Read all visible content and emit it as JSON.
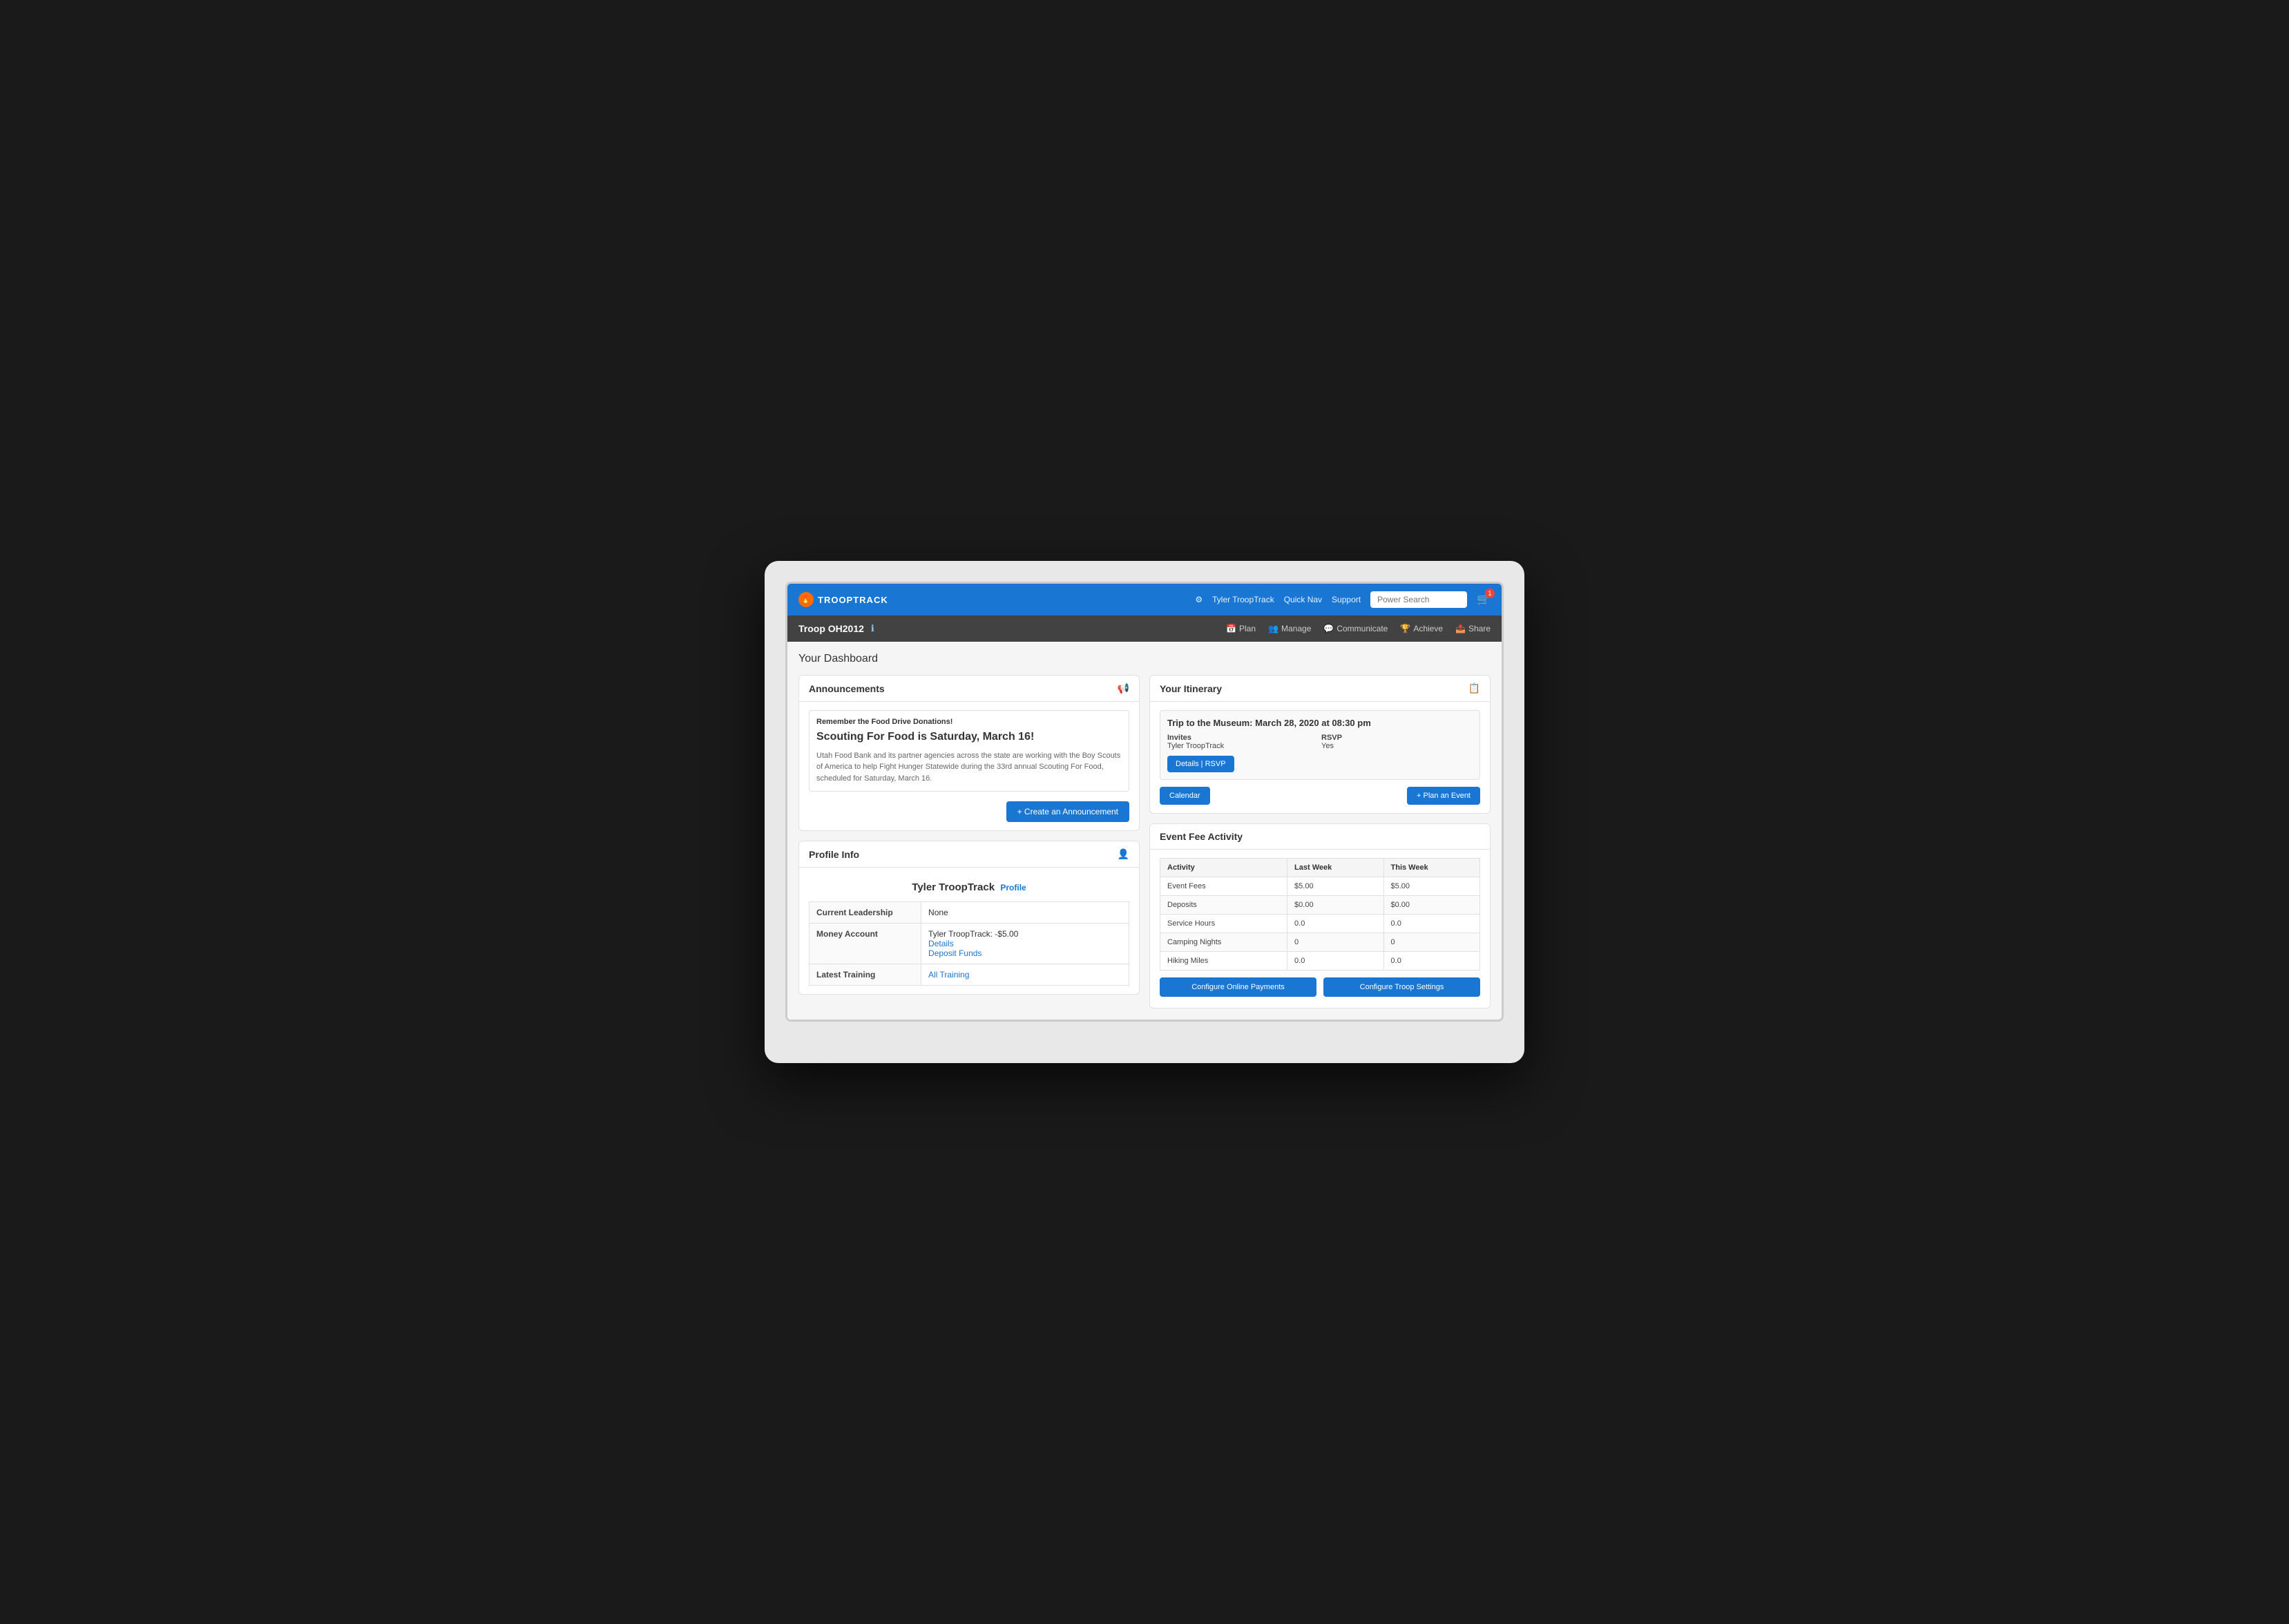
{
  "brand": {
    "name": "TROOPTRACK",
    "icon_label": "flame"
  },
  "top_nav": {
    "user_name": "Tyler TroopTrack",
    "quick_nav": "Quick Nav",
    "support": "Support",
    "search_placeholder": "Power Search",
    "cart_count": "1"
  },
  "secondary_nav": {
    "troop_name": "Troop OH2012",
    "plan": "Plan",
    "manage": "Manage",
    "communicate": "Communicate",
    "achieve": "Achieve",
    "share": "Share"
  },
  "dashboard": {
    "title": "Your Dashboard"
  },
  "announcements": {
    "header": "Announcements",
    "label": "Remember the Food Drive Donations!",
    "title": "Scouting For Food is Saturday, March 16!",
    "body": "Utah Food Bank and its partner agencies across the state are working with the Boy Scouts of America to help Fight Hunger Statewide during the 33rd annual Scouting For Food, scheduled for Saturday, March 16.",
    "create_btn": "+ Create an Announcement"
  },
  "profile_info": {
    "header": "Profile Info",
    "user_name": "Tyler TroopTrack",
    "profile_link": "Profile",
    "current_leadership_label": "Current Leadership",
    "current_leadership_value": "None",
    "money_account_label": "Money Account",
    "money_account_value": "Tyler TroopTrack: -$5.00",
    "details_link": "Details",
    "deposit_link": "Deposit Funds",
    "latest_training_label": "Latest Training",
    "all_training_link": "All Training"
  },
  "itinerary": {
    "header": "Your Itinerary",
    "event_title": "Trip to the Museum: March 28, 2020 at 08:30 pm",
    "invites_label": "Invites",
    "invites_value": "Tyler TroopTrack",
    "rsvp_label": "RSVP",
    "rsvp_value": "Yes",
    "details_rsvp_btn": "Details | RSVP",
    "calendar_btn": "Calendar",
    "plan_event_btn": "+ Plan an Event"
  },
  "event_fee": {
    "header": "Event Fee Activity",
    "columns": [
      "Activity",
      "Last Week",
      "This Week"
    ],
    "rows": [
      {
        "activity": "Event Fees",
        "last_week": "$5.00",
        "this_week": "$5.00"
      },
      {
        "activity": "Deposits",
        "last_week": "$0.00",
        "this_week": "$0.00"
      },
      {
        "activity": "Service Hours",
        "last_week": "0.0",
        "this_week": "0.0"
      },
      {
        "activity": "Camping Nights",
        "last_week": "0",
        "this_week": "0"
      },
      {
        "activity": "Hiking Miles",
        "last_week": "0.0",
        "this_week": "0.0"
      }
    ],
    "configure_payments_btn": "Configure Online Payments",
    "configure_settings_btn": "Configure Troop Settings"
  }
}
